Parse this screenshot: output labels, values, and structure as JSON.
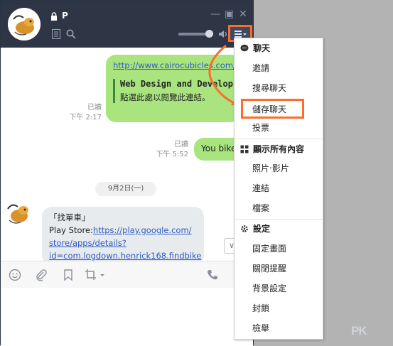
{
  "header": {
    "chat_name": "P",
    "controls": [
      "minimize-icon",
      "maximize-icon",
      "close-icon"
    ],
    "volume_level": 0.9
  },
  "messages": {
    "link_message": {
      "url": "http://www.cairocubicles.com/",
      "preview_title": "Web Design and Develop...",
      "preview_desc": "點選此處以閱覽此連結。"
    },
    "meta1": {
      "read": "已讀",
      "time": "下午 2:17"
    },
    "you_message": "You bike",
    "meta2": {
      "read": "已讀",
      "time": "下午 5:52"
    },
    "date_divider": "9月2日(一)",
    "bot_message": {
      "title": "「找單車」",
      "prefix": "Play Store:",
      "link_line1": "https://play.google.com/",
      "link_line2": "store/apps/details?",
      "link_line3": "id=com.logdown.henrick168.findbike"
    }
  },
  "toolbar": {
    "tools": [
      "emoji-icon",
      "attach-icon",
      "bookmark-icon",
      "crop-icon",
      "call-icon"
    ]
  },
  "menu": {
    "chat_header": "聊天",
    "chat_items": [
      "邀請",
      "搜尋聊天",
      "儲存聊天",
      "投票"
    ],
    "show_header": "顯示所有內容",
    "show_items": [
      "照片‧影片",
      "連結",
      "檔案"
    ],
    "settings_header": "設定",
    "settings_items": [
      "固定畫面",
      "關閉提醒",
      "背景設定",
      "封鎖",
      "檢舉"
    ]
  },
  "highlight": {
    "color": "#ff6b2b"
  },
  "watermark": "PK"
}
